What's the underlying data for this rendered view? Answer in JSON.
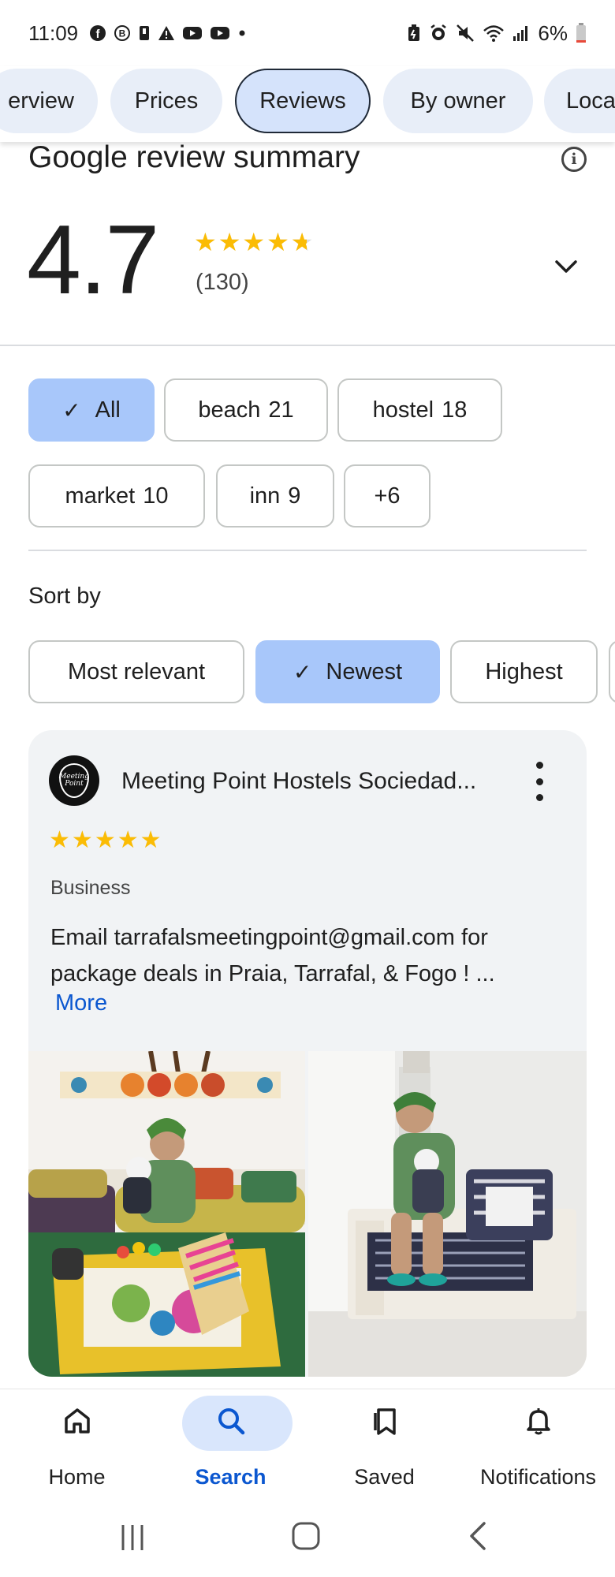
{
  "status_bar": {
    "time": "11:09",
    "battery": "6%",
    "notification_icons": [
      "facebook-icon",
      "b-app-icon",
      "lock-icon",
      "warning-icon",
      "youtube-icon",
      "youtube-icon",
      "dot-icon"
    ],
    "system_icons": [
      "battery-saver-icon",
      "alarm-icon",
      "mute-icon",
      "wifi-icon",
      "signal-icon",
      "battery-icon"
    ]
  },
  "tabs": [
    {
      "label": "Overview",
      "visible_text": "erview",
      "active": false
    },
    {
      "label": "Prices",
      "active": false
    },
    {
      "label": "Reviews",
      "active": true
    },
    {
      "label": "By owner",
      "active": false
    },
    {
      "label": "Location",
      "visible_text": "Loca",
      "active": false
    }
  ],
  "summary": {
    "title": "Google review summary",
    "rating": "4.7",
    "stars": 4.7,
    "count": "(130)"
  },
  "topic_chips": [
    {
      "label": "All",
      "count": "",
      "selected": true
    },
    {
      "label": "beach",
      "count": "21",
      "selected": false
    },
    {
      "label": "hostel",
      "count": "18",
      "selected": false
    },
    {
      "label": "market",
      "count": "10",
      "selected": false
    },
    {
      "label": "inn",
      "count": "9",
      "selected": false
    },
    {
      "label": "+6",
      "count": "",
      "selected": false
    }
  ],
  "sort": {
    "label": "Sort by",
    "options": [
      {
        "label": "Most relevant",
        "selected": false
      },
      {
        "label": "Newest",
        "selected": true
      },
      {
        "label": "Highest",
        "selected": false
      }
    ]
  },
  "review": {
    "reviewer": "Meeting Point Hostels Sociedad...",
    "avatar_text": "Meeting Point",
    "stars": 5,
    "badge": "Business",
    "text": "Email tarrafalsmeetingpoint@gmail.com for package deals in Praia, Tarrafal, & Fogo ! ...",
    "more_label": "More"
  },
  "bottom_nav": [
    {
      "label": "Home",
      "icon": "home-icon",
      "active": false
    },
    {
      "label": "Search",
      "icon": "search-icon",
      "active": true
    },
    {
      "label": "Saved",
      "icon": "bookmark-icon",
      "active": false
    },
    {
      "label": "Notifications",
      "icon": "bell-icon",
      "active": false
    }
  ],
  "colors": {
    "accent": "#0b57d0",
    "selected_chip": "#a8c7fa",
    "star": "#fbbc04",
    "card_bg": "#f1f3f5"
  }
}
